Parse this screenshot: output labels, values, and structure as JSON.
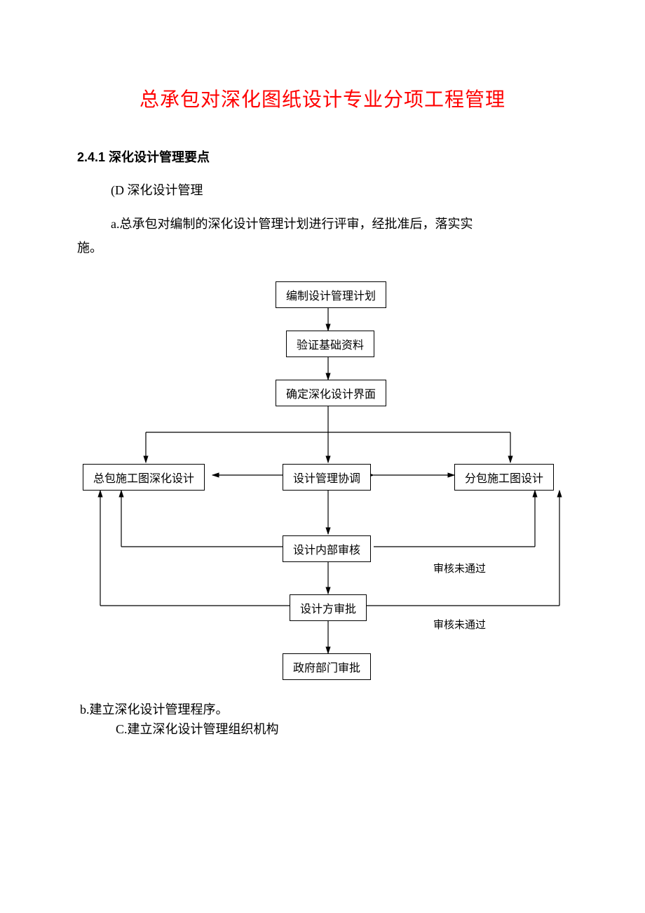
{
  "title": "总承包对深化图纸设计专业分项工程管理",
  "section_heading": "2.4.1 深化设计管理要点",
  "para_d": "(D 深化设计管理",
  "para_a": "a.总承包对编制的深化设计管理计划进行评审，经批准后，落实实",
  "para_a2": "施。",
  "flow": {
    "n1": "编制设计管理计划",
    "n2": "验证基础资料",
    "n3": "确定深化设计界面",
    "n4a": "总包施工图深化设计",
    "n4b": "设计管理协调",
    "n4c": "分包施工图设计",
    "n5": "设计内部审核",
    "n6": "设计方审批",
    "n7": "政府部门审批",
    "fail1": "审核未通过",
    "fail2": "审核未通过"
  },
  "para_b": "b.建立深化设计管理程序。",
  "para_c": "C.建立深化设计管理组织机构",
  "chart_data": {
    "type": "flowchart",
    "nodes": [
      {
        "id": "n1",
        "label": "编制设计管理计划"
      },
      {
        "id": "n2",
        "label": "验证基础资料"
      },
      {
        "id": "n3",
        "label": "确定深化设计界面"
      },
      {
        "id": "n4a",
        "label": "总包施工图深化设计"
      },
      {
        "id": "n4b",
        "label": "设计管理协调"
      },
      {
        "id": "n4c",
        "label": "分包施工图设计"
      },
      {
        "id": "n5",
        "label": "设计内部审核"
      },
      {
        "id": "n6",
        "label": "设计方审批"
      },
      {
        "id": "n7",
        "label": "政府部门审批"
      }
    ],
    "edges": [
      {
        "from": "n1",
        "to": "n2"
      },
      {
        "from": "n2",
        "to": "n3"
      },
      {
        "from": "n3",
        "to": "n4a"
      },
      {
        "from": "n3",
        "to": "n4b"
      },
      {
        "from": "n3",
        "to": "n4c"
      },
      {
        "from": "n4b",
        "to": "n4a",
        "bidirectional": true
      },
      {
        "from": "n4b",
        "to": "n4c",
        "bidirectional": true
      },
      {
        "from": "n4b",
        "to": "n5"
      },
      {
        "from": "n5",
        "to": "n6"
      },
      {
        "from": "n6",
        "to": "n7"
      },
      {
        "from": "n5",
        "to": "n4a",
        "label": "审核未通过",
        "feedback": true
      },
      {
        "from": "n5",
        "to": "n4c",
        "label": "审核未通过",
        "feedback": true
      },
      {
        "from": "n6",
        "to": "n4a",
        "label": "审核未通过",
        "feedback": true
      },
      {
        "from": "n6",
        "to": "n4c",
        "label": "审核未通过",
        "feedback": true
      }
    ]
  }
}
